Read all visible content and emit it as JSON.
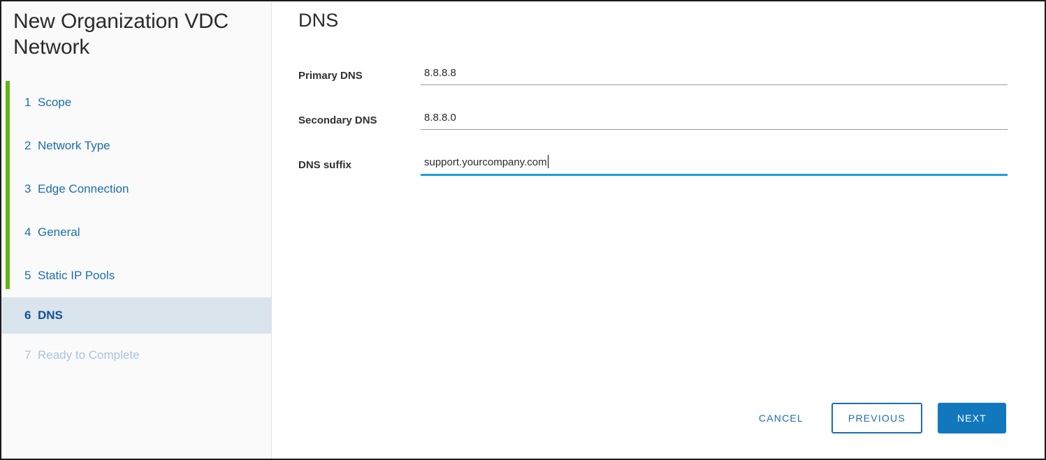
{
  "wizard": {
    "title": "New Organization VDC Network",
    "steps": [
      {
        "num": "1",
        "label": "Scope",
        "state": "complete"
      },
      {
        "num": "2",
        "label": "Network Type",
        "state": "complete"
      },
      {
        "num": "3",
        "label": "Edge Connection",
        "state": "complete"
      },
      {
        "num": "4",
        "label": "General",
        "state": "complete"
      },
      {
        "num": "5",
        "label": "Static IP Pools",
        "state": "complete"
      },
      {
        "num": "6",
        "label": "DNS",
        "state": "active"
      },
      {
        "num": "7",
        "label": "Ready to Complete",
        "state": "disabled"
      }
    ]
  },
  "page": {
    "heading": "DNS",
    "fields": [
      {
        "label": "Primary DNS",
        "value": "8.8.8.8",
        "placeholder": "",
        "focused": false
      },
      {
        "label": "Secondary DNS",
        "value": "8.8.8.0",
        "placeholder": "",
        "focused": false
      },
      {
        "label": "DNS suffix",
        "value": "support.yourcompany.com",
        "placeholder": "",
        "focused": true
      }
    ]
  },
  "footer": {
    "cancel_label": "CANCEL",
    "previous_label": "PREVIOUS",
    "next_label": "NEXT"
  },
  "colors": {
    "accent_blue": "#1278be",
    "link_blue": "#1b6ead",
    "active_step_bg": "#d9e4ed",
    "active_step_text": "#12508f",
    "disabled_step_text": "#a8c4de",
    "progress_green": "#60b515",
    "focused_underline": "#1a9fd9",
    "underline_gray": "#999999"
  }
}
